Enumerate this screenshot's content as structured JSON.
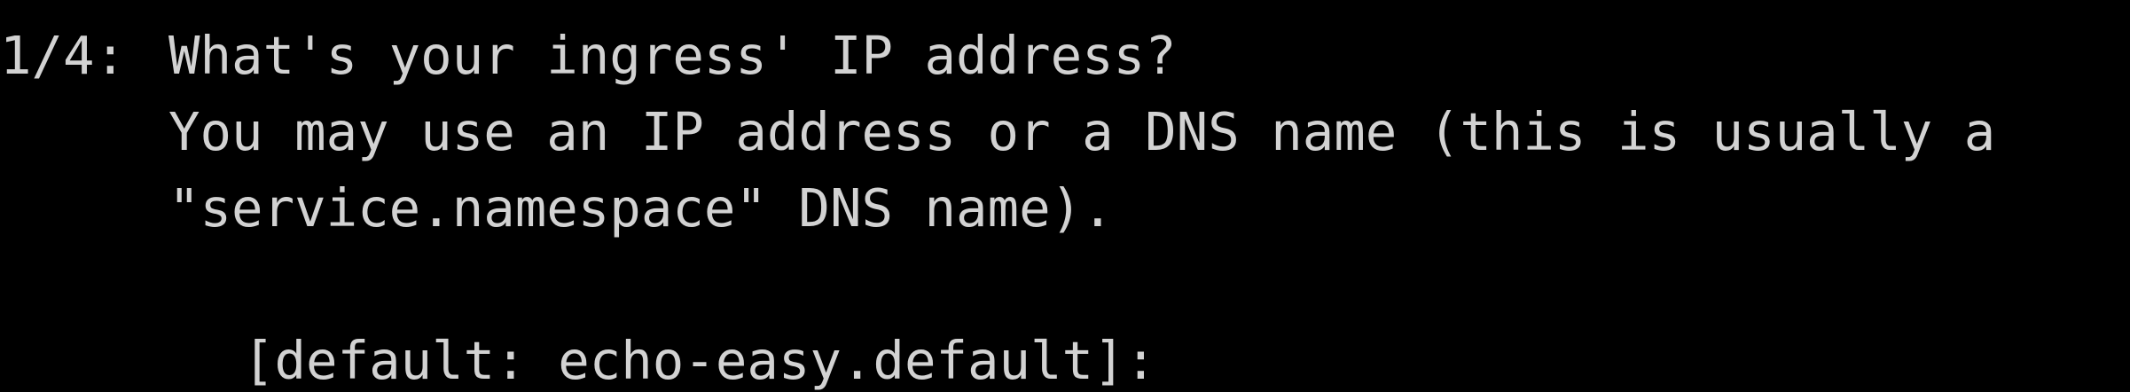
{
  "terminal": {
    "step": "1/4:",
    "question": "What's your ingress' IP address?",
    "help_line_1": "You may use an IP address or a DNS name (this is usually a",
    "help_line_2": "\"service.namespace\" DNS name).",
    "prompt": "[default: echo-easy.default]:"
  }
}
